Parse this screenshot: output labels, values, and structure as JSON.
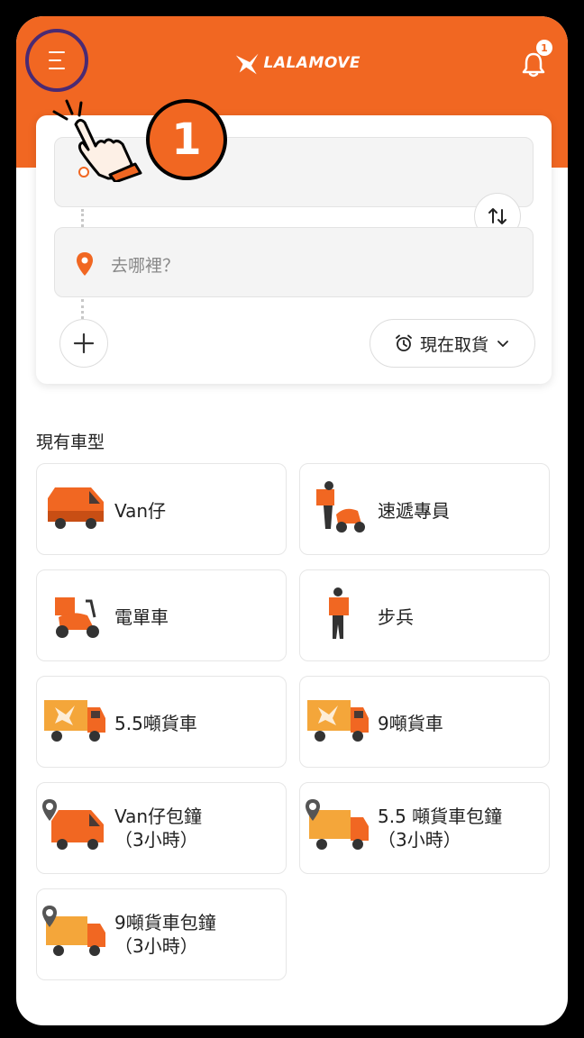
{
  "header": {
    "logo_text": "LALAMOVE",
    "notification_count": "1",
    "brand_color": "#f16722"
  },
  "tutorial": {
    "step_number": "1"
  },
  "route": {
    "pickup_placeholder": "",
    "dropoff_placeholder": "去哪裡？",
    "pickup_time_label": "現在取貨"
  },
  "vehicles": {
    "section_title": "現有車型",
    "items": [
      {
        "label": "Van仔",
        "icon": "van-icon"
      },
      {
        "label": "速遞專員",
        "icon": "motorcycle-courier-icon"
      },
      {
        "label": "電單車",
        "icon": "motorcycle-icon"
      },
      {
        "label": "步兵",
        "icon": "walker-icon"
      },
      {
        "label": "5.5噸貨車",
        "icon": "truck-icon"
      },
      {
        "label": "9噸貨車",
        "icon": "truck-icon"
      },
      {
        "label_line1": "Van仔包鐘",
        "label_line2": "（3小時）",
        "icon": "van-hourly-icon"
      },
      {
        "label_line1": "5.5 噸貨車包鐘",
        "label_line2": "（3小時）",
        "icon": "truck-hourly-icon"
      },
      {
        "label_line1": "9噸貨車包鐘",
        "label_line2": "（3小時）",
        "icon": "truck-hourly-icon"
      }
    ]
  }
}
